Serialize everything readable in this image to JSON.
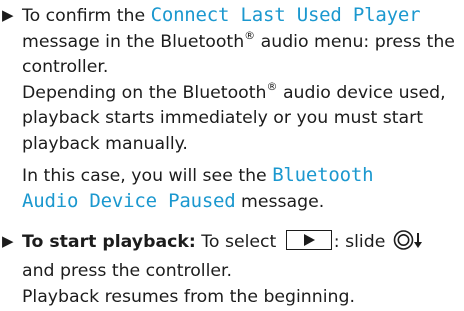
{
  "step1": {
    "bullet": "▶",
    "intro": "To confirm the ",
    "display_msg": "Connect Last Used Player",
    "line_a": " message in the Bluetooth",
    "reg": "®",
    "line_b": " audio menu: press the controller.",
    "depending_a": "Depending on the Bluetooth",
    "depending_b": " audio device used, playback starts immediately or you must start playback manually.",
    "case_intro": "In this case, you will see the ",
    "display_msg2_line1": "Bluetooth",
    "display_msg2_line2": "Audio Device Paused",
    "case_end": " message."
  },
  "step2": {
    "bullet": "▶",
    "label": "To start playback:",
    "text_a": " To select ",
    "text_b": ": slide ",
    "text_c": " and press the controller.",
    "result": "Playback resumes from the beginning."
  },
  "colors": {
    "display_text": "#1b98cf",
    "body_text": "#1c1c1c"
  },
  "icons": {
    "bullet": "triangle-bullet-icon",
    "play_button": "play-button-icon",
    "controller": "controller-slide-down-icon"
  }
}
